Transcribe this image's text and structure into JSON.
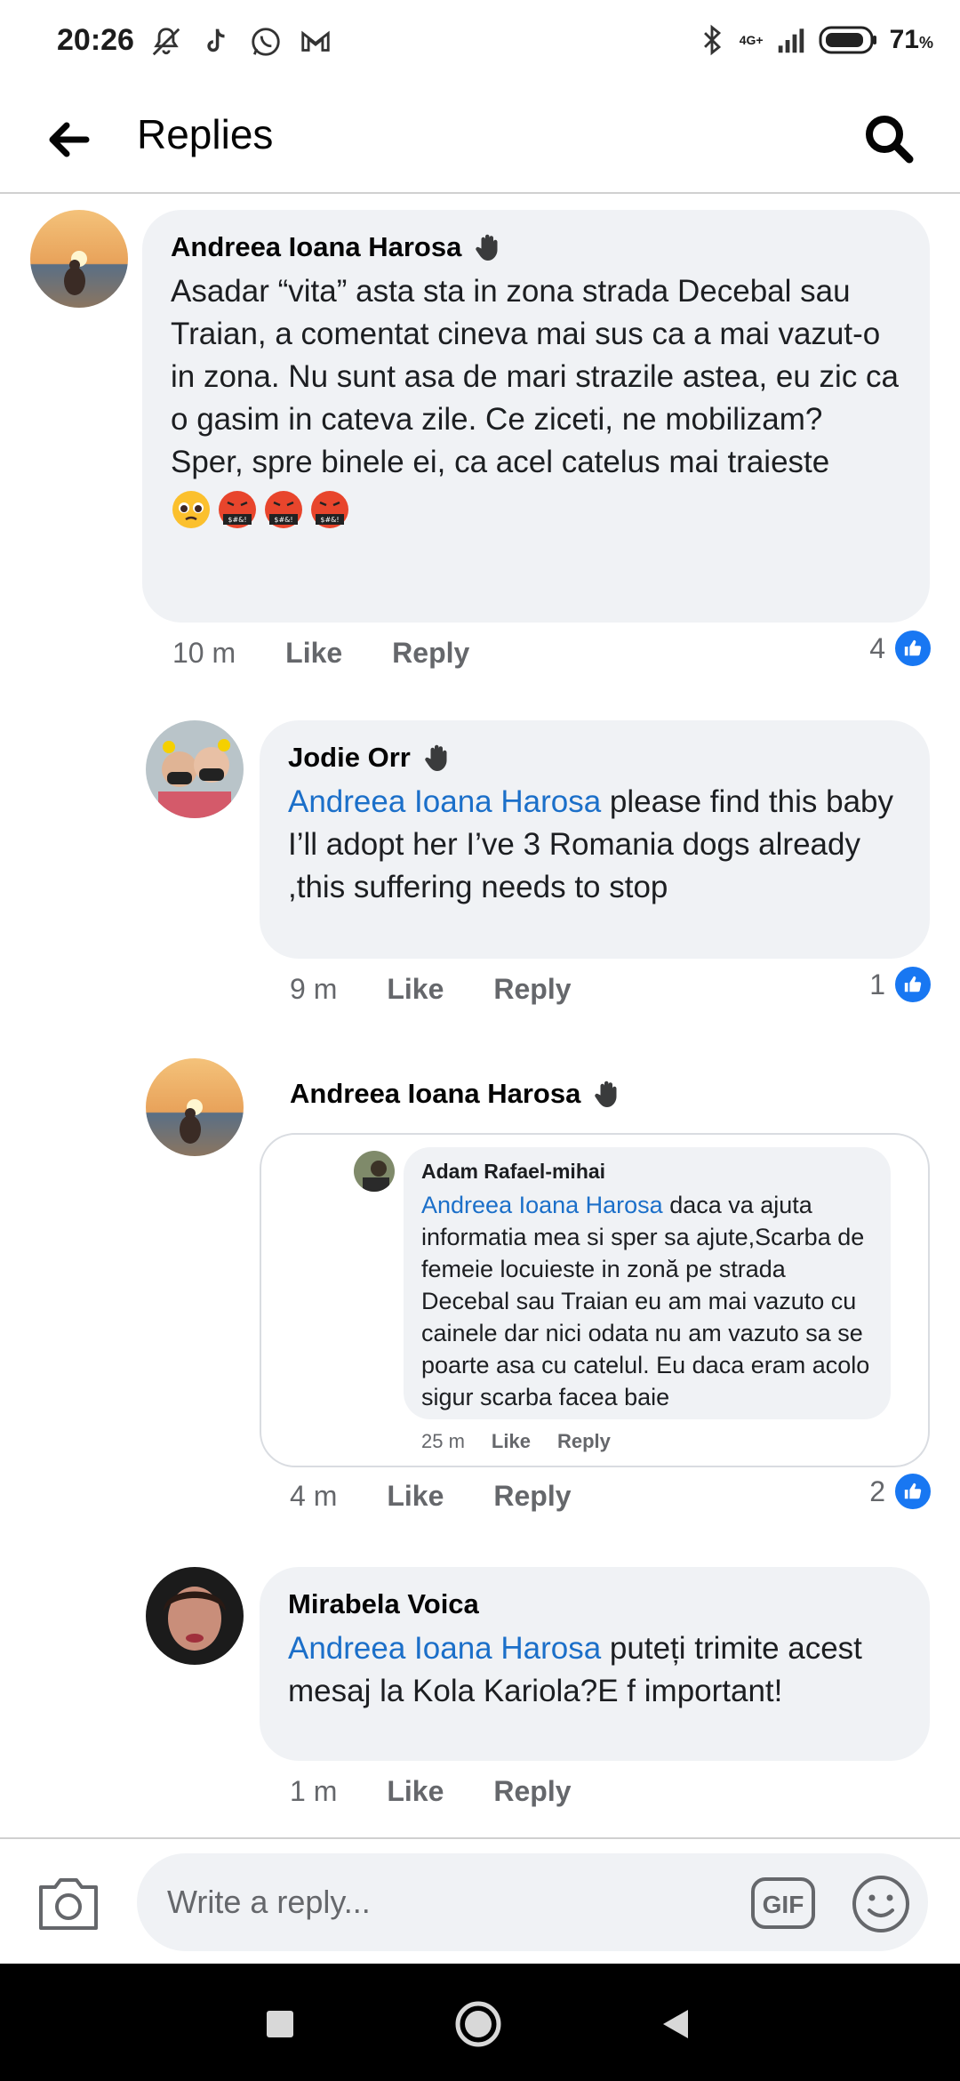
{
  "status_bar": {
    "time": "20:26",
    "network": "4G+",
    "battery": "71",
    "battery_unit": "%"
  },
  "header": {
    "title": "Replies"
  },
  "comments": [
    {
      "author": "Andreea Ioana Harosa",
      "text": "Asadar “vita” asta sta in zona strada Decebal sau Traian, a comentat cineva mai sus ca a mai vazut-o in zona. Nu sunt asa de mari strazile astea, eu zic ca o gasim in cateva zile. Ce ziceti, ne mobilizam?\nSper, spre binele ei, ca acel catelus mai traieste",
      "emojis": [
        "pleading-face",
        "cursing-face",
        "cursing-face",
        "cursing-face"
      ],
      "time": "10 m",
      "like_label": "Like",
      "reply_label": "Reply",
      "reaction_count": "4"
    },
    {
      "author": "Jodie Orr",
      "mention": "Andreea Ioana Harosa",
      "text": " please find this baby I’ll adopt her I’ve 3 Romania dogs already ,this suffering needs to stop",
      "time": "9 m",
      "like_label": "Like",
      "reply_label": "Reply",
      "reaction_count": "1"
    },
    {
      "author": "Andreea Ioana Harosa",
      "embedded": {
        "author": "Adam Rafael-mihai",
        "mention": "Andreea Ioana Harosa",
        "text": " daca va ajuta informatia mea si sper sa ajute,Scarba de femeie locuieste in zonă pe strada Decebal sau Traian eu am mai vazuto cu cainele dar nici odata nu am vazuto sa se poarte asa cu catelul. Eu daca eram acolo sigur scarba facea baie",
        "time": "25 m",
        "like_label": "Like",
        "reply_label": "Reply"
      },
      "time": "4 m",
      "like_label": "Like",
      "reply_label": "Reply",
      "reaction_count": "2"
    },
    {
      "author": "Mirabela Voica",
      "mention": "Andreea Ioana Harosa",
      "text": " puteți trimite acest mesaj la Kola Kariola?E f important!",
      "time": "1 m",
      "like_label": "Like",
      "reply_label": "Reply"
    }
  ],
  "composer": {
    "placeholder": "Write a reply...",
    "gif_label": "GIF"
  },
  "colors": {
    "mention": "#1b6fc9",
    "like_blue": "#1877f2",
    "bubble": "#f0f2f5"
  }
}
